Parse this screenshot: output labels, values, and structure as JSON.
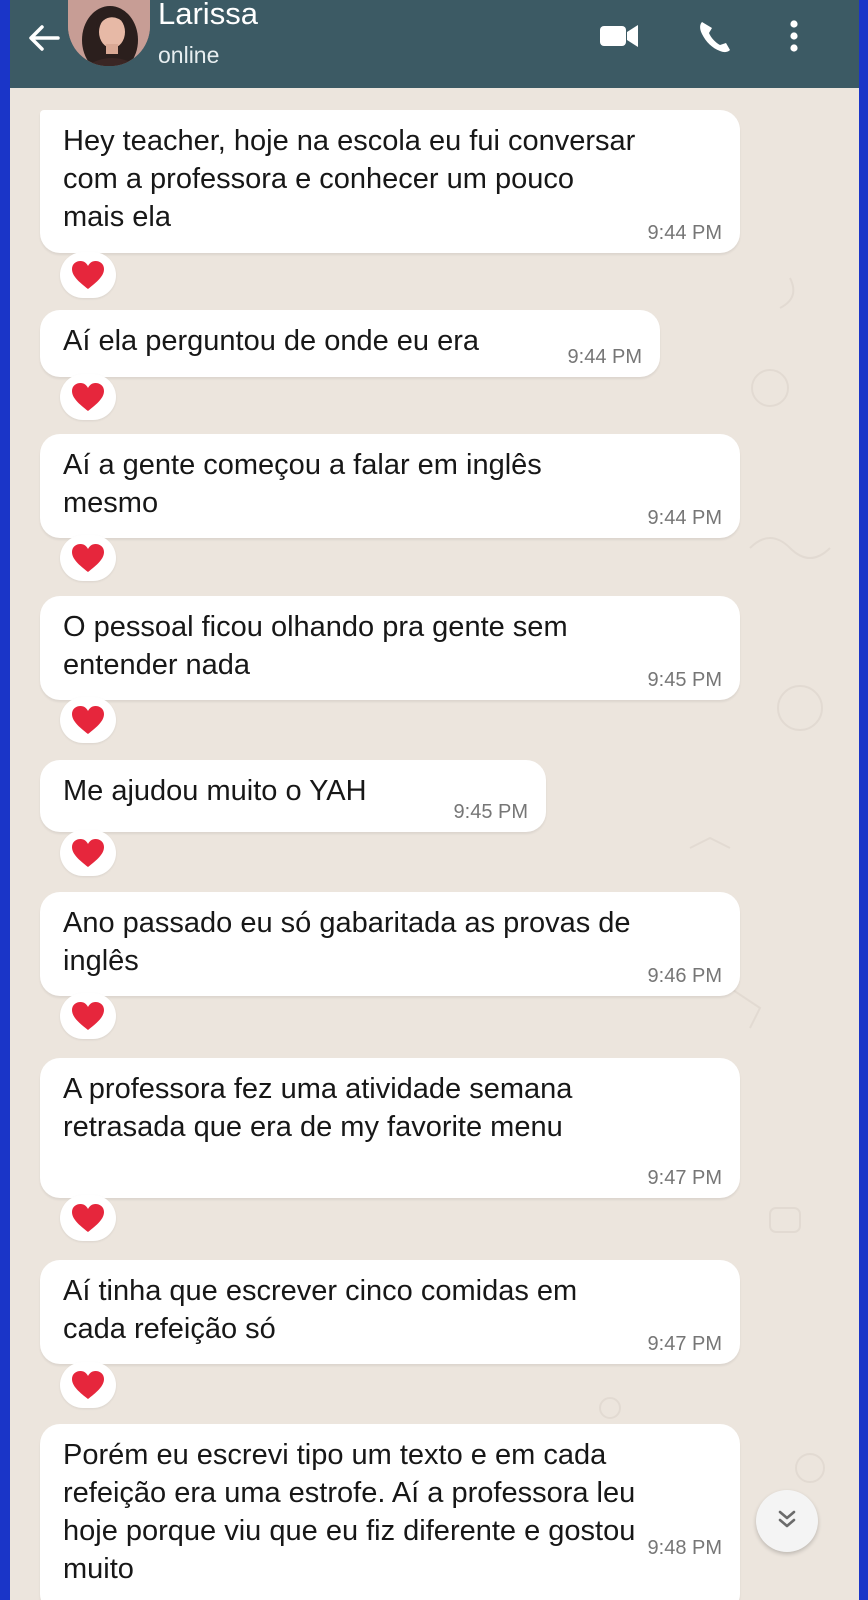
{
  "header": {
    "contact_name": "Larissa",
    "status": "online",
    "icons": [
      "back-arrow-icon",
      "video-call-icon",
      "voice-call-icon",
      "more-options-icon"
    ],
    "background": "#3c5a64"
  },
  "chat": {
    "wallpaper_color": "#ece5dd",
    "reaction": "❤️",
    "messages": [
      {
        "text": "Hey teacher, hoje na escola eu fui conversar\ncom a professora e conhecer um pouco\nmais ela",
        "time": "9:44 PM"
      },
      {
        "text": "Aí ela perguntou de onde eu era",
        "time": "9:44 PM"
      },
      {
        "text": "Aí a gente começou a falar em inglês\nmesmo",
        "time": "9:44 PM"
      },
      {
        "text": "O pessoal ficou olhando pra gente sem\nentender nada",
        "time": "9:45 PM"
      },
      {
        "text": "Me ajudou muito o YAH",
        "time": "9:45 PM"
      },
      {
        "text": "Ano passado eu só gabaritada as provas de\ninglês",
        "time": "9:46 PM"
      },
      {
        "text": "A professora fez uma atividade semana\nretrasada que era de my favorite menu",
        "time": "9:47 PM"
      },
      {
        "text": "Aí tinha que escrever cinco comidas em\ncada refeição só",
        "time": "9:47 PM"
      },
      {
        "text": "Porém eu escrevi tipo um texto e em cada\nrefeição era uma estrofe. Aí a professora leu\nhoje porque viu que eu fiz diferente e gostou\nmuito",
        "time": "9:48 PM"
      }
    ]
  },
  "scroll_down_icon": "double-chevron-down-icon"
}
